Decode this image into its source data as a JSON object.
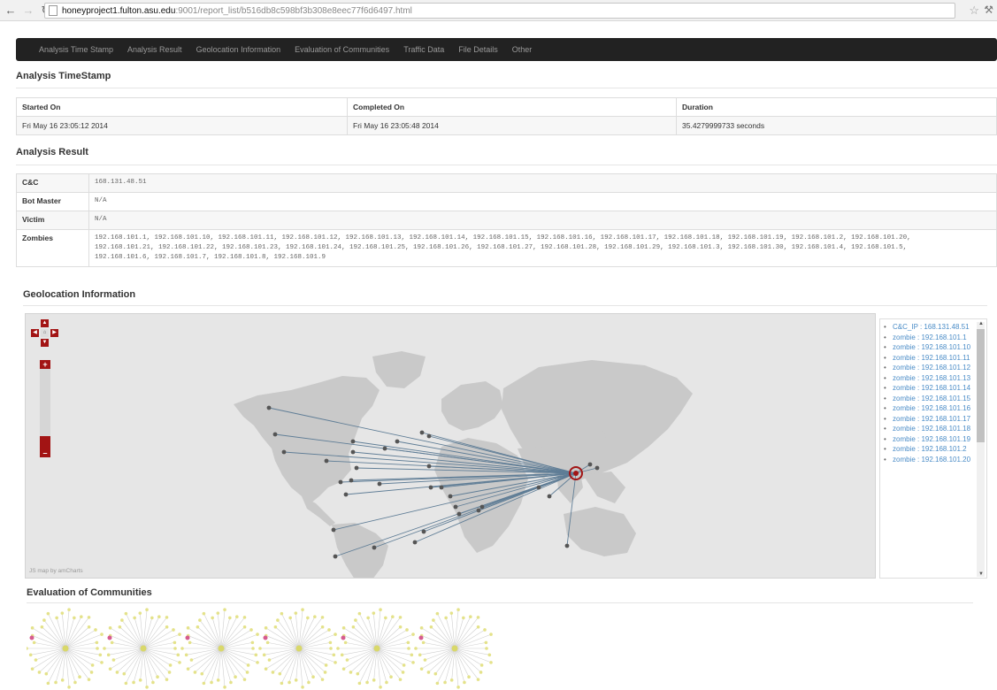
{
  "browser": {
    "url_host": "honeyproject1.fulton.asu.edu",
    "url_rest": ":9001/report_list/b516db8c598bf3b308e8eec77f6d6497.html"
  },
  "nav": [
    "Analysis Time Stamp",
    "Analysis Result",
    "Geolocation Information",
    "Evaluation of Communities",
    "Traffic Data",
    "File Details",
    "Other"
  ],
  "timestamp": {
    "title": "Analysis TimeStamp",
    "headers": [
      "Started On",
      "Completed On",
      "Duration"
    ],
    "values": [
      "Fri May 16 23:05:12 2014",
      "Fri May 16 23:05:48 2014",
      "35.4279999733 seconds"
    ]
  },
  "result": {
    "title": "Analysis Result",
    "cc_label": "C&C",
    "cc_value": "168.131.48.51",
    "botmaster_label": "Bot Master",
    "botmaster_value": "N/A",
    "victim_label": "Victim",
    "victim_value": "N/A",
    "zombies_label": "Zombies",
    "zombies_line1": "192.168.101.1, 192.168.101.10, 192.168.101.11, 192.168.101.12, 192.168.101.13, 192.168.101.14, 192.168.101.15, 192.168.101.16, 192.168.101.17, 192.168.101.18, 192.168.101.19, 192.168.101.2, 192.168.101.20,",
    "zombies_line2": "192.168.101.21, 192.168.101.22, 192.168.101.23, 192.168.101.24, 192.168.101.25, 192.168.101.26, 192.168.101.27, 192.168.101.28, 192.168.101.29, 192.168.101.3, 192.168.101.30, 192.168.101.4, 192.168.101.5,",
    "zombies_line3": "192.168.101.6, 192.168.101.7, 192.168.101.8, 192.168.101.9"
  },
  "geo": {
    "title": "Geolocation Information",
    "credit": "JS map by amCharts",
    "legend": [
      "C&C_IP : 168.131.48.51",
      "zombie : 192.168.101.1",
      "zombie : 192.168.101.10",
      "zombie : 192.168.101.11",
      "zombie : 192.168.101.12",
      "zombie : 192.168.101.13",
      "zombie : 192.168.101.14",
      "zombie : 192.168.101.15",
      "zombie : 192.168.101.16",
      "zombie : 192.168.101.17",
      "zombie : 192.168.101.18",
      "zombie : 192.168.101.19",
      "zombie : 192.168.101.2",
      "zombie : 192.168.101.20"
    ]
  },
  "communities": {
    "title": "Evaluation of Communities"
  },
  "colors": {
    "accent_red": "#a21414",
    "nav_bg": "#222222",
    "link_blue": "#4a8cc7"
  }
}
